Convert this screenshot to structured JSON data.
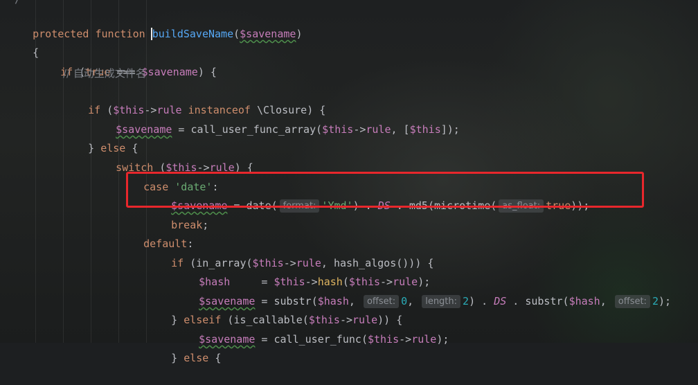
{
  "editor": {
    "top_fragment": "*/",
    "lines": {
      "l1": {
        "kw1": "protected",
        "kw2": "function",
        "fn": "buildSaveName",
        "p1": "(",
        "var": "$savename",
        "p2": ")"
      },
      "l2": {
        "brace": "{"
      },
      "l3": {
        "kw": "if",
        "p1": " (",
        "kw2": "true",
        "op": " === ",
        "var": "$savename",
        "p2": ") {"
      },
      "l4": {
        "comment": "// 自动生成文件名"
      },
      "l5": {
        "kw": "if",
        "p1": " (",
        "var": "$this",
        "arrow": "->",
        "prop": "rule",
        "sp": " ",
        "kw2": "instanceof",
        "cls": " \\Closure) {"
      },
      "l6": {
        "var": "$savename",
        "eq": " = ",
        "fn": "call_user_func_array",
        "p1": "(",
        "var2": "$this",
        "arrow": "->",
        "prop": "rule",
        "p2": ", [",
        "var3": "$this",
        "p3": "]);"
      },
      "l7": {
        "p1": "} ",
        "kw": "else",
        "p2": " {"
      },
      "l8": {
        "kw": "switch",
        "p1": " (",
        "var": "$this",
        "arrow": "->",
        "prop": "rule",
        "p2": ") {"
      },
      "l9": {
        "kw": "case",
        "sp": " ",
        "str": "'date'",
        "p": ":"
      },
      "l10": {
        "var": "$savename",
        "eq": " = ",
        "fn": "date",
        "p1": "(",
        "hint": "format:",
        "str": "'Ymd'",
        "p2": ") . ",
        "const": "DS",
        "p3": " . ",
        "fn2": "md5",
        "p4": "(",
        "fn3": "microtime",
        "p5": "(",
        "hint2": "as_float:",
        "kw": "true",
        "p6": "));"
      },
      "l11": {
        "kw": "break",
        "p": ";"
      },
      "l12": {
        "kw": "default",
        "p": ":"
      },
      "l13": {
        "kw": "if",
        "p1": " (",
        "fn": "in_array",
        "p2": "(",
        "var": "$this",
        "arrow": "->",
        "prop": "rule",
        "p3": ", ",
        "fn2": "hash_algos",
        "p4": "())) {"
      },
      "l14": {
        "var": "$hash",
        "eq": "     = ",
        "var2": "$this",
        "arrow": "->",
        "meth": "hash",
        "p1": "(",
        "var3": "$this",
        "arrow2": "->",
        "prop": "rule",
        "p2": ");"
      },
      "l15": {
        "var": "$savename",
        "eq": " = ",
        "fn": "substr",
        "p1": "(",
        "var2": "$hash",
        "p2": ", ",
        "hint": "offset:",
        "num": "0",
        "p3": ", ",
        "hint2": "length:",
        "num2": "2",
        "p4": ") . ",
        "const": "DS",
        "p5": " . ",
        "fn2": "substr",
        "p6": "(",
        "var3": "$hash",
        "p7": ", ",
        "hint3": "offset:",
        "num3": "2",
        "p8": ");"
      },
      "l16": {
        "p1": "} ",
        "kw": "elseif",
        "p2": " (",
        "fn": "is_callable",
        "p3": "(",
        "var": "$this",
        "arrow": "->",
        "prop": "rule",
        "p4": ")) {"
      },
      "l17": {
        "var": "$savename",
        "eq": " = ",
        "fn": "call_user_func",
        "p1": "(",
        "var2": "$this",
        "arrow": "->",
        "prop": "rule",
        "p2": ");"
      },
      "l18": {
        "p1": "} ",
        "kw": "else",
        "p2": " {"
      }
    }
  },
  "colors": {
    "keyword": "#cf8e6d",
    "function": "#56a8f5",
    "variable": "#c77dbb",
    "string": "#6aab73",
    "number": "#2aacb8",
    "comment": "#7a7e85",
    "highlight_box": "#e8272c"
  }
}
